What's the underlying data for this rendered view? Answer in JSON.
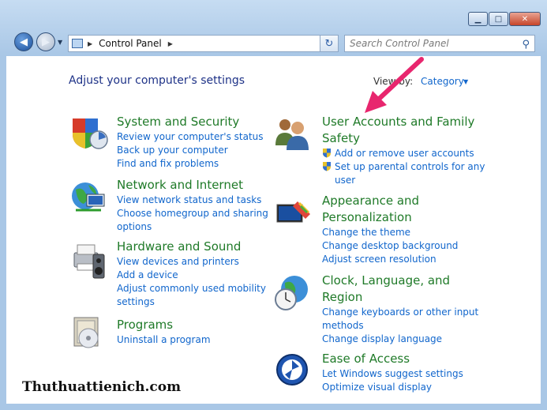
{
  "window": {
    "minimize_glyph": "▁",
    "maximize_glyph": "□",
    "close_glyph": "✕"
  },
  "navbar": {
    "back_glyph": "◀",
    "forward_glyph": "▶",
    "address_label": "Control Panel",
    "search_placeholder": "Search Control Panel",
    "refresh_glyph": "↻"
  },
  "main": {
    "heading": "Adjust your computer's settings",
    "view_by_label": "View by:",
    "view_by_value": "Category"
  },
  "categories": [
    {
      "title": "System and Security",
      "links": [
        "Review your computer's status",
        "Back up your computer",
        "Find and fix problems"
      ]
    },
    {
      "title": "Network and Internet",
      "links": [
        "View network status and tasks",
        "Choose homegroup and sharing",
        "options"
      ]
    },
    {
      "title": "Hardware and Sound",
      "links": [
        "View devices and printers",
        "Add a device",
        "Adjust commonly used mobility",
        "settings"
      ]
    },
    {
      "title": "Programs",
      "links": [
        "Uninstall a program"
      ]
    },
    {
      "title": [
        "User Accounts and Family",
        "Safety"
      ],
      "links": [
        "Add or remove user accounts",
        "Set up parental controls for any",
        "user"
      ]
    },
    {
      "title": [
        "Appearance and",
        "Personalization"
      ],
      "links": [
        "Change the theme",
        "Change desktop background",
        "Adjust screen resolution"
      ]
    },
    {
      "title": [
        "Clock, Language, and",
        "Region"
      ],
      "links": [
        "Change keyboards or other input",
        "methods",
        "Change display language"
      ]
    },
    {
      "title": "Ease of Access",
      "links": [
        "Let Windows suggest settings",
        "Optimize visual display"
      ]
    }
  ],
  "watermark": "Thuthuattienich.com",
  "colors": {
    "title_green": "#1f7a28",
    "link_blue": "#1166cc",
    "heading_blue": "#1e3287",
    "arrow_pink": "#e8266e"
  }
}
